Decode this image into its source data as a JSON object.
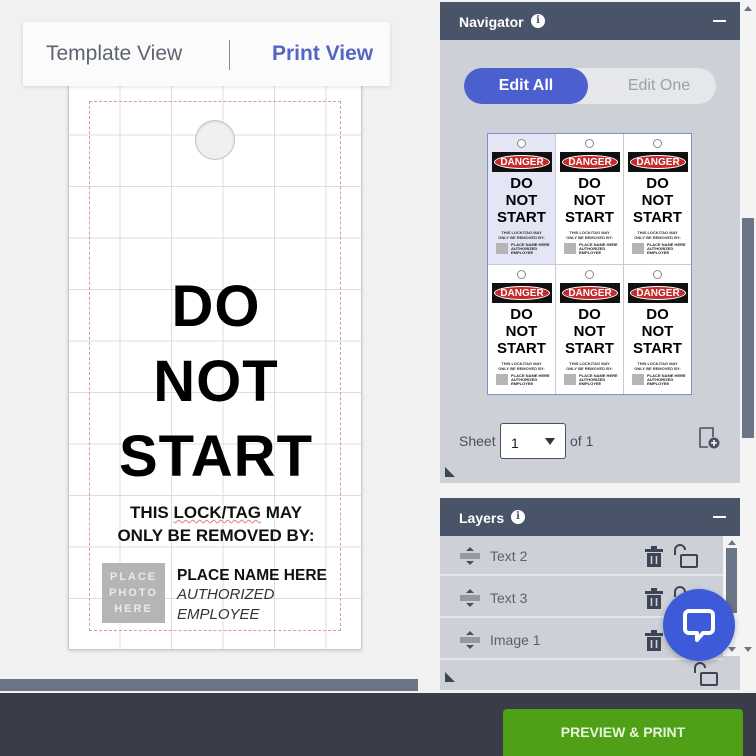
{
  "view_toggle": {
    "template_view": "Template View",
    "print_view": "Print View",
    "active": "Print View"
  },
  "tag_design": {
    "line1": "DO",
    "line2": "NOT",
    "line3": "START",
    "removal_text_pre": "THIS ",
    "removal_text_underlined": "LOCK/TAG",
    "removal_text_post": " MAY",
    "removal_text_line2": "ONLY BE REMOVED BY:",
    "photo_placeholder": [
      "PLACE",
      "PHOTO",
      "HERE"
    ],
    "name_placeholder": "PLACE NAME HERE",
    "role_line1": "AUTHORIZED",
    "role_line2": "EMPLOYEE"
  },
  "navigator": {
    "title": "Navigator",
    "info_icon": "info-icon",
    "edit_all": "Edit All",
    "edit_one": "Edit One",
    "active_mode": "Edit All",
    "thumbnails": [
      {
        "header": "DANGER",
        "l1": "DO",
        "l2": "NOT",
        "l3": "START",
        "fine1": "THIS LOCK/TAG MAY",
        "fine2": "ONLY BE REMOVED BY:",
        "n1": "PLACE NAME HERE",
        "n2": "AUTHORIZED",
        "n3": "EMPLOYEE",
        "selected": true
      },
      {
        "header": "DANGER",
        "l1": "DO",
        "l2": "NOT",
        "l3": "START",
        "fine1": "THIS LOCK/TAG MAY",
        "fine2": "ONLY BE REMOVED BY:",
        "n1": "PLACE NAME HERE",
        "n2": "AUTHORIZED",
        "n3": "EMPLOYEE",
        "selected": false
      },
      {
        "header": "DANGER",
        "l1": "DO",
        "l2": "NOT",
        "l3": "START",
        "fine1": "THIS LOCK/TAG MAY",
        "fine2": "ONLY BE REMOVED BY:",
        "n1": "PLACE NAME HERE",
        "n2": "AUTHORIZED",
        "n3": "EMPLOYEE",
        "selected": false
      },
      {
        "header": "DANGER",
        "l1": "DO",
        "l2": "NOT",
        "l3": "START",
        "fine1": "THIS LOCK/TAG MAY",
        "fine2": "ONLY BE REMOVED BY:",
        "n1": "PLACE NAME HERE",
        "n2": "AUTHORIZED",
        "n3": "EMPLOYEE",
        "selected": false
      },
      {
        "header": "DANGER",
        "l1": "DO",
        "l2": "NOT",
        "l3": "START",
        "fine1": "THIS LOCK/TAG MAY",
        "fine2": "ONLY BE REMOVED BY:",
        "n1": "PLACE NAME HERE",
        "n2": "AUTHORIZED",
        "n3": "EMPLOYEE",
        "selected": false
      },
      {
        "header": "DANGER",
        "l1": "DO",
        "l2": "NOT",
        "l3": "START",
        "fine1": "THIS LOCK/TAG MAY",
        "fine2": "ONLY BE REMOVED BY:",
        "n1": "PLACE NAME HERE",
        "n2": "AUTHORIZED",
        "n3": "EMPLOYEE",
        "selected": false
      }
    ],
    "sheet_label": "Sheet",
    "sheet_value": "1",
    "sheet_of": "of 1"
  },
  "layers": {
    "title": "Layers",
    "items": [
      {
        "name": "Text 2"
      },
      {
        "name": "Text 3"
      },
      {
        "name": "Image 1"
      }
    ]
  },
  "footer": {
    "preview_print": "PREVIEW & PRINT"
  },
  "colors": {
    "accent": "#4b5fcf",
    "panel_header": "#4a5468",
    "primary_action": "#4fa017",
    "danger_red": "#c42a2a"
  }
}
